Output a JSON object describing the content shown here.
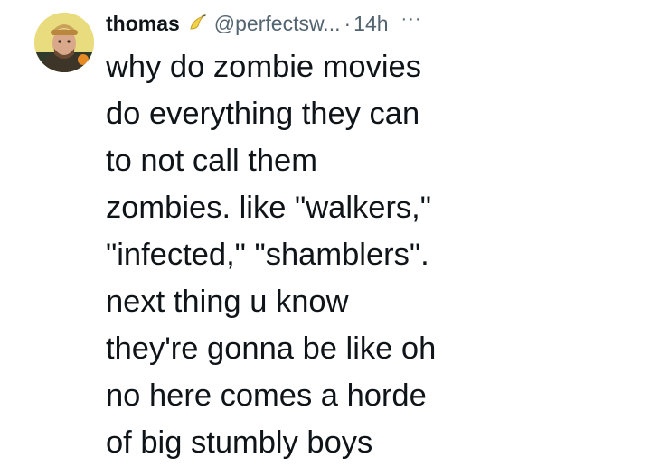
{
  "tweet": {
    "author": {
      "display_name": "thomas",
      "badge_icon": "banana-icon",
      "handle": "@perfectsw...",
      "separator": "·",
      "timestamp": "14h",
      "more_label": "···"
    },
    "text": "why do zombie movies\ndo everything they can\nto not call them\nzombies. like \"walkers,\"\n\"infected,\" \"shamblers\".\nnext thing u know\nthey're gonna be like oh\nno here comes a horde\nof big stumbly boys"
  },
  "colors": {
    "primary_text": "#0f1419",
    "secondary_text": "#536471",
    "background": "#ffffff"
  }
}
